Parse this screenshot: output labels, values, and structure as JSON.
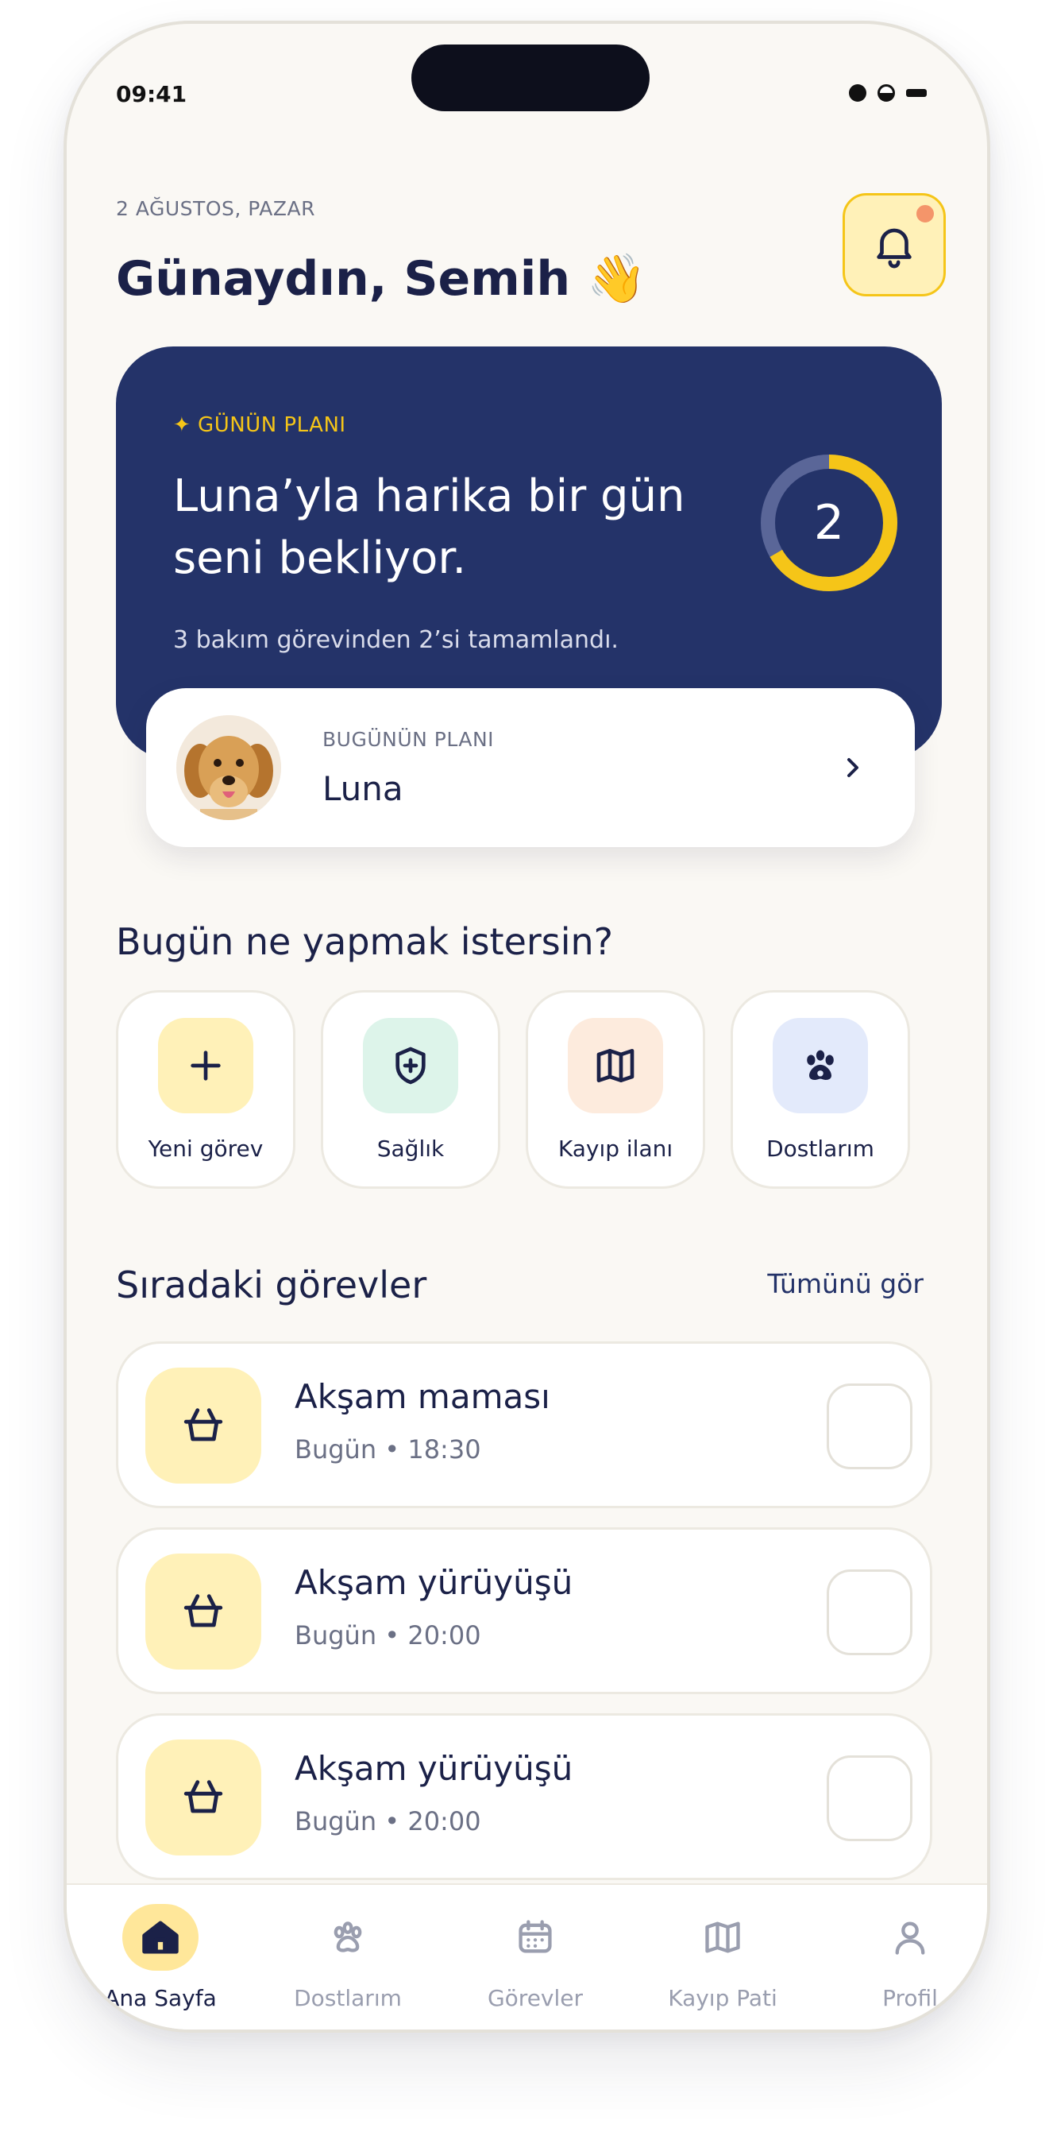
{
  "status_bar": {
    "time": "09:41"
  },
  "header": {
    "date": "2 AĞUSTOS, PAZAR",
    "greeting": "Günaydın, Semih 👋",
    "notification_icon": "bell-icon"
  },
  "plan_card": {
    "tag": "✦ GÜNÜN PLANI",
    "title": "Luna’yla harika bir gün seni bekliyor.",
    "subtitle": "3 bakım görevinden 2’si tamamlandı.",
    "completed_count": "2",
    "progress": {
      "completed": 2,
      "total": 3
    },
    "colors": {
      "card_bg": "#243369",
      "accent": "#F5C518"
    }
  },
  "pet_card": {
    "label": "BUGÜNÜN PLANI",
    "name": "Luna"
  },
  "quick_actions": {
    "title": "Bugün ne yapmak istersin?",
    "items": [
      {
        "label": "Yeni görev",
        "icon": "plus-icon",
        "bg": "#FFF1B8"
      },
      {
        "label": "Sağlık",
        "icon": "shield-plus-icon",
        "bg": "#DDF4EA"
      },
      {
        "label": "Kayıp ilanı",
        "icon": "map-icon",
        "bg": "#FDEBDD"
      },
      {
        "label": "Dostlarım",
        "icon": "paw-icon",
        "bg": "#E3EAFB"
      }
    ]
  },
  "tasks": {
    "title": "Sıradaki görevler",
    "see_all": "Tümünü gör",
    "items": [
      {
        "title": "Akşam maması",
        "meta": "Bugün • 18:30",
        "icon": "basket-icon",
        "done": false
      },
      {
        "title": "Akşam yürüyüşü",
        "meta": "Bugün • 20:00",
        "icon": "basket-icon",
        "done": false
      },
      {
        "title": "Akşam yürüyüşü",
        "meta": "Bugün • 20:00",
        "icon": "basket-icon",
        "done": false
      }
    ]
  },
  "tabbar": {
    "items": [
      {
        "label": "Ana Sayfa",
        "icon": "home-icon",
        "active": true
      },
      {
        "label": "Dostlarım",
        "icon": "paw-icon",
        "active": false
      },
      {
        "label": "Görevler",
        "icon": "calendar-icon",
        "active": false
      },
      {
        "label": "Kayıp Pati",
        "icon": "map-icon",
        "active": false
      },
      {
        "label": "Profil",
        "icon": "user-icon",
        "active": false
      }
    ]
  }
}
